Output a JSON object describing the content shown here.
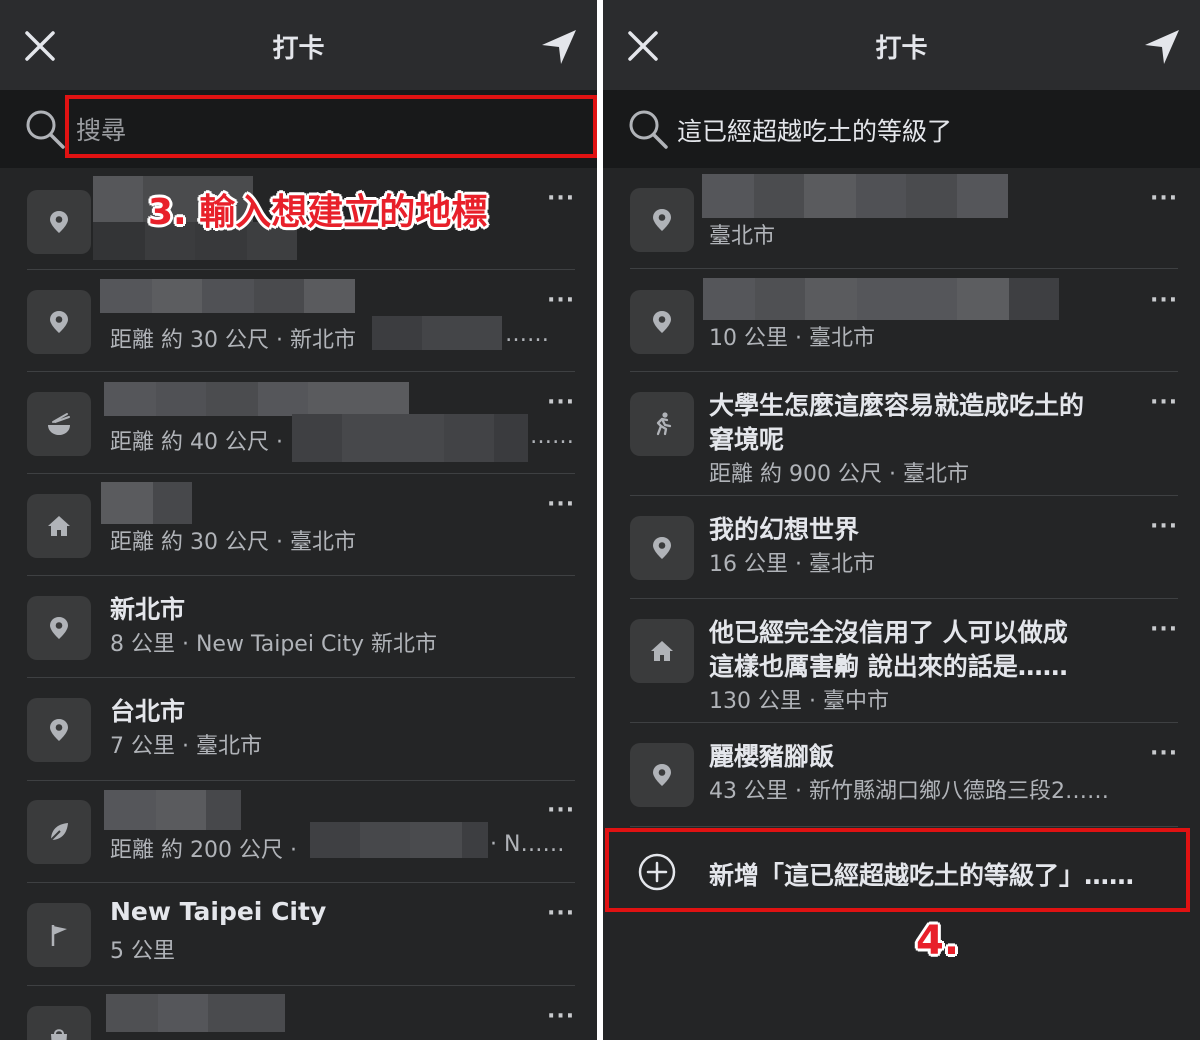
{
  "left": {
    "header": {
      "title": "打卡"
    },
    "search": {
      "placeholder": "搜尋"
    },
    "annotation": "3. 輸入想建立的地標",
    "rows": [
      {
        "icon": "map-pin-icon",
        "name": "",
        "sub": "",
        "sub_tail": ""
      },
      {
        "icon": "map-pin-icon",
        "name": "",
        "sub": "距離 約 30 公尺 · 新北市",
        "sub_tail": "……"
      },
      {
        "icon": "food-bowl-icon",
        "name": "",
        "sub": "距離 約 40 公尺 ·",
        "sub_tail": "……"
      },
      {
        "icon": "house-icon",
        "name": "",
        "sub": "距離 約 30 公尺 · 臺北市",
        "sub_tail": ""
      },
      {
        "icon": "map-pin-icon",
        "name": "新北市",
        "sub": "8 公里 · New Taipei City 新北市",
        "sub_tail": ""
      },
      {
        "icon": "map-pin-icon",
        "name": "台北市",
        "sub": "7 公里 · 臺北市",
        "sub_tail": ""
      },
      {
        "icon": "leaf-icon",
        "name": "",
        "sub": "距離 約 200 公尺 ·",
        "sub_tail": "· N……"
      },
      {
        "icon": "flag-icon",
        "name": "New Taipei City",
        "sub": "5 公里",
        "sub_tail": ""
      },
      {
        "icon": "shopping-bag-icon",
        "name": "",
        "sub": "",
        "sub_tail": ""
      }
    ]
  },
  "right": {
    "header": {
      "title": "打卡"
    },
    "search": {
      "query": "這已經超越吃土的等級了"
    },
    "annotation": "4.",
    "rows": [
      {
        "icon": "map-pin-icon",
        "name": "",
        "sub": "臺北市"
      },
      {
        "icon": "map-pin-icon",
        "name": "",
        "sub": "10 公里 · 臺北市"
      },
      {
        "icon": "running-person-icon",
        "name_line1": "大學生怎麼這麼容易就造成吃土的",
        "name_line2": "窘境呢",
        "sub": "距離 約 900 公尺 · 臺北市"
      },
      {
        "icon": "map-pin-icon",
        "name_line1": "我的幻想世界",
        "sub": "16 公里 · 臺北市"
      },
      {
        "icon": "house-icon",
        "name_line1": "他已經完全沒信用了 人可以做成",
        "name_line2": "這樣也厲害齁 說出來的話是……",
        "sub": "130 公里 · 臺中市"
      },
      {
        "icon": "map-pin-icon",
        "name_line1": "麗櫻豬腳飯",
        "sub": "43 公里 · 新竹縣湖口鄉八德路三段2……"
      }
    ],
    "add_label": "新增「這已經超越吃土的等級了」……"
  },
  "more_label": "···",
  "colors": {
    "accent_red": "#e01212",
    "background": "#242526",
    "header": "#2b2c2e",
    "search_bg": "#18191a"
  }
}
